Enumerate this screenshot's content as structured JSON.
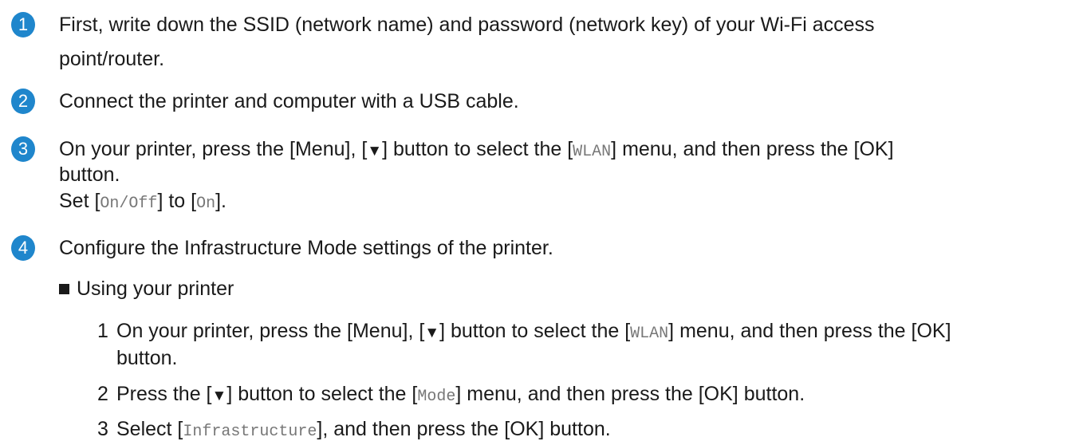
{
  "steps": [
    {
      "number": "1",
      "line1": "First, write down the SSID (network name) and password (network key) of your Wi-Fi access",
      "line2": "point/router."
    },
    {
      "number": "2",
      "line1": "Connect the printer and computer with a USB cable."
    },
    {
      "number": "3",
      "line1_a": "On your printer, press the [Menu], [",
      "arrow": "▼",
      "line1_b": "] button to select the [",
      "code_wlan": "WLAN",
      "line1_c": "] menu, and then press the [OK]",
      "line2": "button.",
      "line3_a": "Set [",
      "code_onoff": "On/Off",
      "line3_b": "] to [",
      "code_on": "On",
      "line3_c": "]."
    },
    {
      "number": "4",
      "line1": "Configure the Infrastructure Mode settings of the printer."
    }
  ],
  "bullet": {
    "label": "Using your printer"
  },
  "substeps": [
    {
      "number": "1",
      "a": "On your printer, press the [Menu], [",
      "arrow": "▼",
      "b": "] button to select the [",
      "code": "WLAN",
      "c": "] menu, and then press the [OK]",
      "line2": "button."
    },
    {
      "number": "2",
      "a": "Press the [",
      "arrow": "▼",
      "b": "] button to select the [",
      "code": "Mode",
      "c": "] menu, and then press the [OK] button."
    },
    {
      "number": "3",
      "a": "Select [",
      "code": "Infrastructure",
      "c": "], and then press the [OK] button."
    }
  ],
  "colors": {
    "badge": "#1f86cc",
    "text": "#1a1a1a",
    "code": "#777777"
  }
}
